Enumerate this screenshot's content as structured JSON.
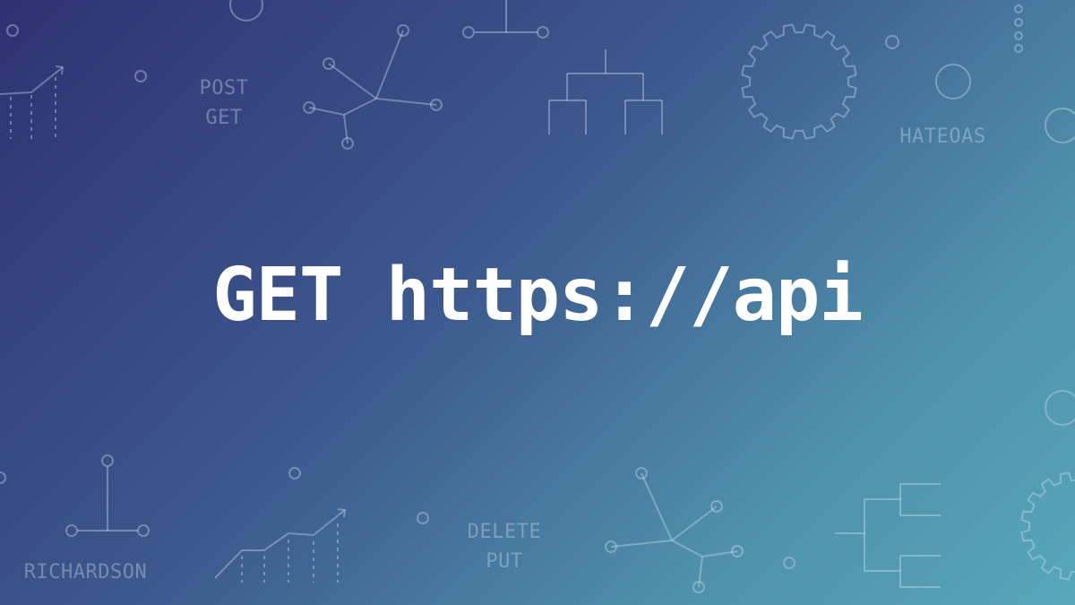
{
  "headline": {
    "method": "GET",
    "url": "https://api"
  },
  "background_words": {
    "post": "POST",
    "get": "GET",
    "hateoas": "HATEOAS",
    "richardson": "RICHARDSON",
    "delete": "DELETE",
    "put": "PUT"
  },
  "colors": {
    "gradient_start": "#2e3272",
    "gradient_end": "#57a7bb",
    "headline": "#ffffff"
  }
}
